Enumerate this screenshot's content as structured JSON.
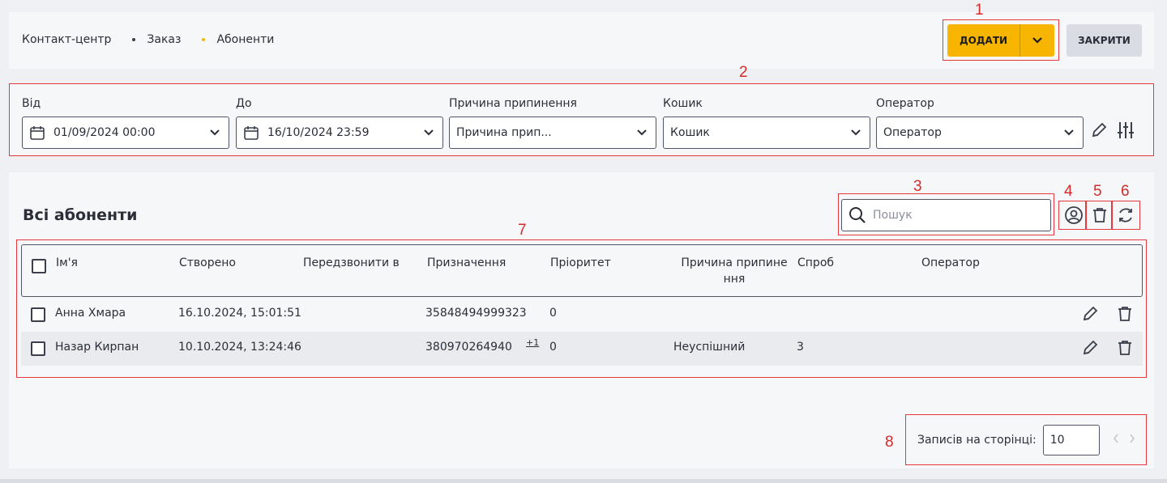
{
  "breadcrumb": {
    "items": [
      {
        "label": "Контакт-центр",
        "dot": ""
      },
      {
        "label": "Заказ",
        "dot": "#3b3f4b"
      },
      {
        "label": "Абоненти",
        "dot": "#f7b500"
      }
    ]
  },
  "header": {
    "add_label": "ДОДАТИ",
    "close_label": "ЗАКРИТИ"
  },
  "filters": {
    "from": {
      "label": "Від",
      "value": "01/09/2024 00:00"
    },
    "to": {
      "label": "До",
      "value": "16/10/2024 23:59"
    },
    "reason": {
      "label": "Причина припинення",
      "value": "Причина прип..."
    },
    "basket": {
      "label": "Кошик",
      "value": "Кошик"
    },
    "operator": {
      "label": "Оператор",
      "value": "Оператор"
    }
  },
  "main": {
    "title": "Всі абоненти",
    "search_placeholder": "Пошук"
  },
  "table": {
    "columns": [
      "Ім'я",
      "Створено",
      "Передзвонити в",
      "Призначення",
      "Пріоритет",
      "Причина припине",
      "ння",
      "Спроб",
      "Оператор"
    ],
    "rows": [
      {
        "name": "Анна Хмара",
        "created": "16.10.2024, 15:01:51",
        "callback": "",
        "destination": "35848494999323",
        "extra": "",
        "priority": "0",
        "reason": "",
        "attempts": "",
        "operator": ""
      },
      {
        "name": "Назар Кирпан",
        "created": "10.10.2024, 13:24:46",
        "callback": "",
        "destination": "380970264940",
        "extra": "+1",
        "priority": "0",
        "reason": "Неуспішний",
        "attempts": "3",
        "operator": ""
      }
    ]
  },
  "pager": {
    "label": "Записів на сторінці:",
    "value": "10"
  },
  "annotations": [
    "1",
    "2",
    "3",
    "4",
    "5",
    "6",
    "7",
    "8"
  ],
  "colors": {
    "accent": "#f7b500",
    "annotation": "#e5393f"
  }
}
